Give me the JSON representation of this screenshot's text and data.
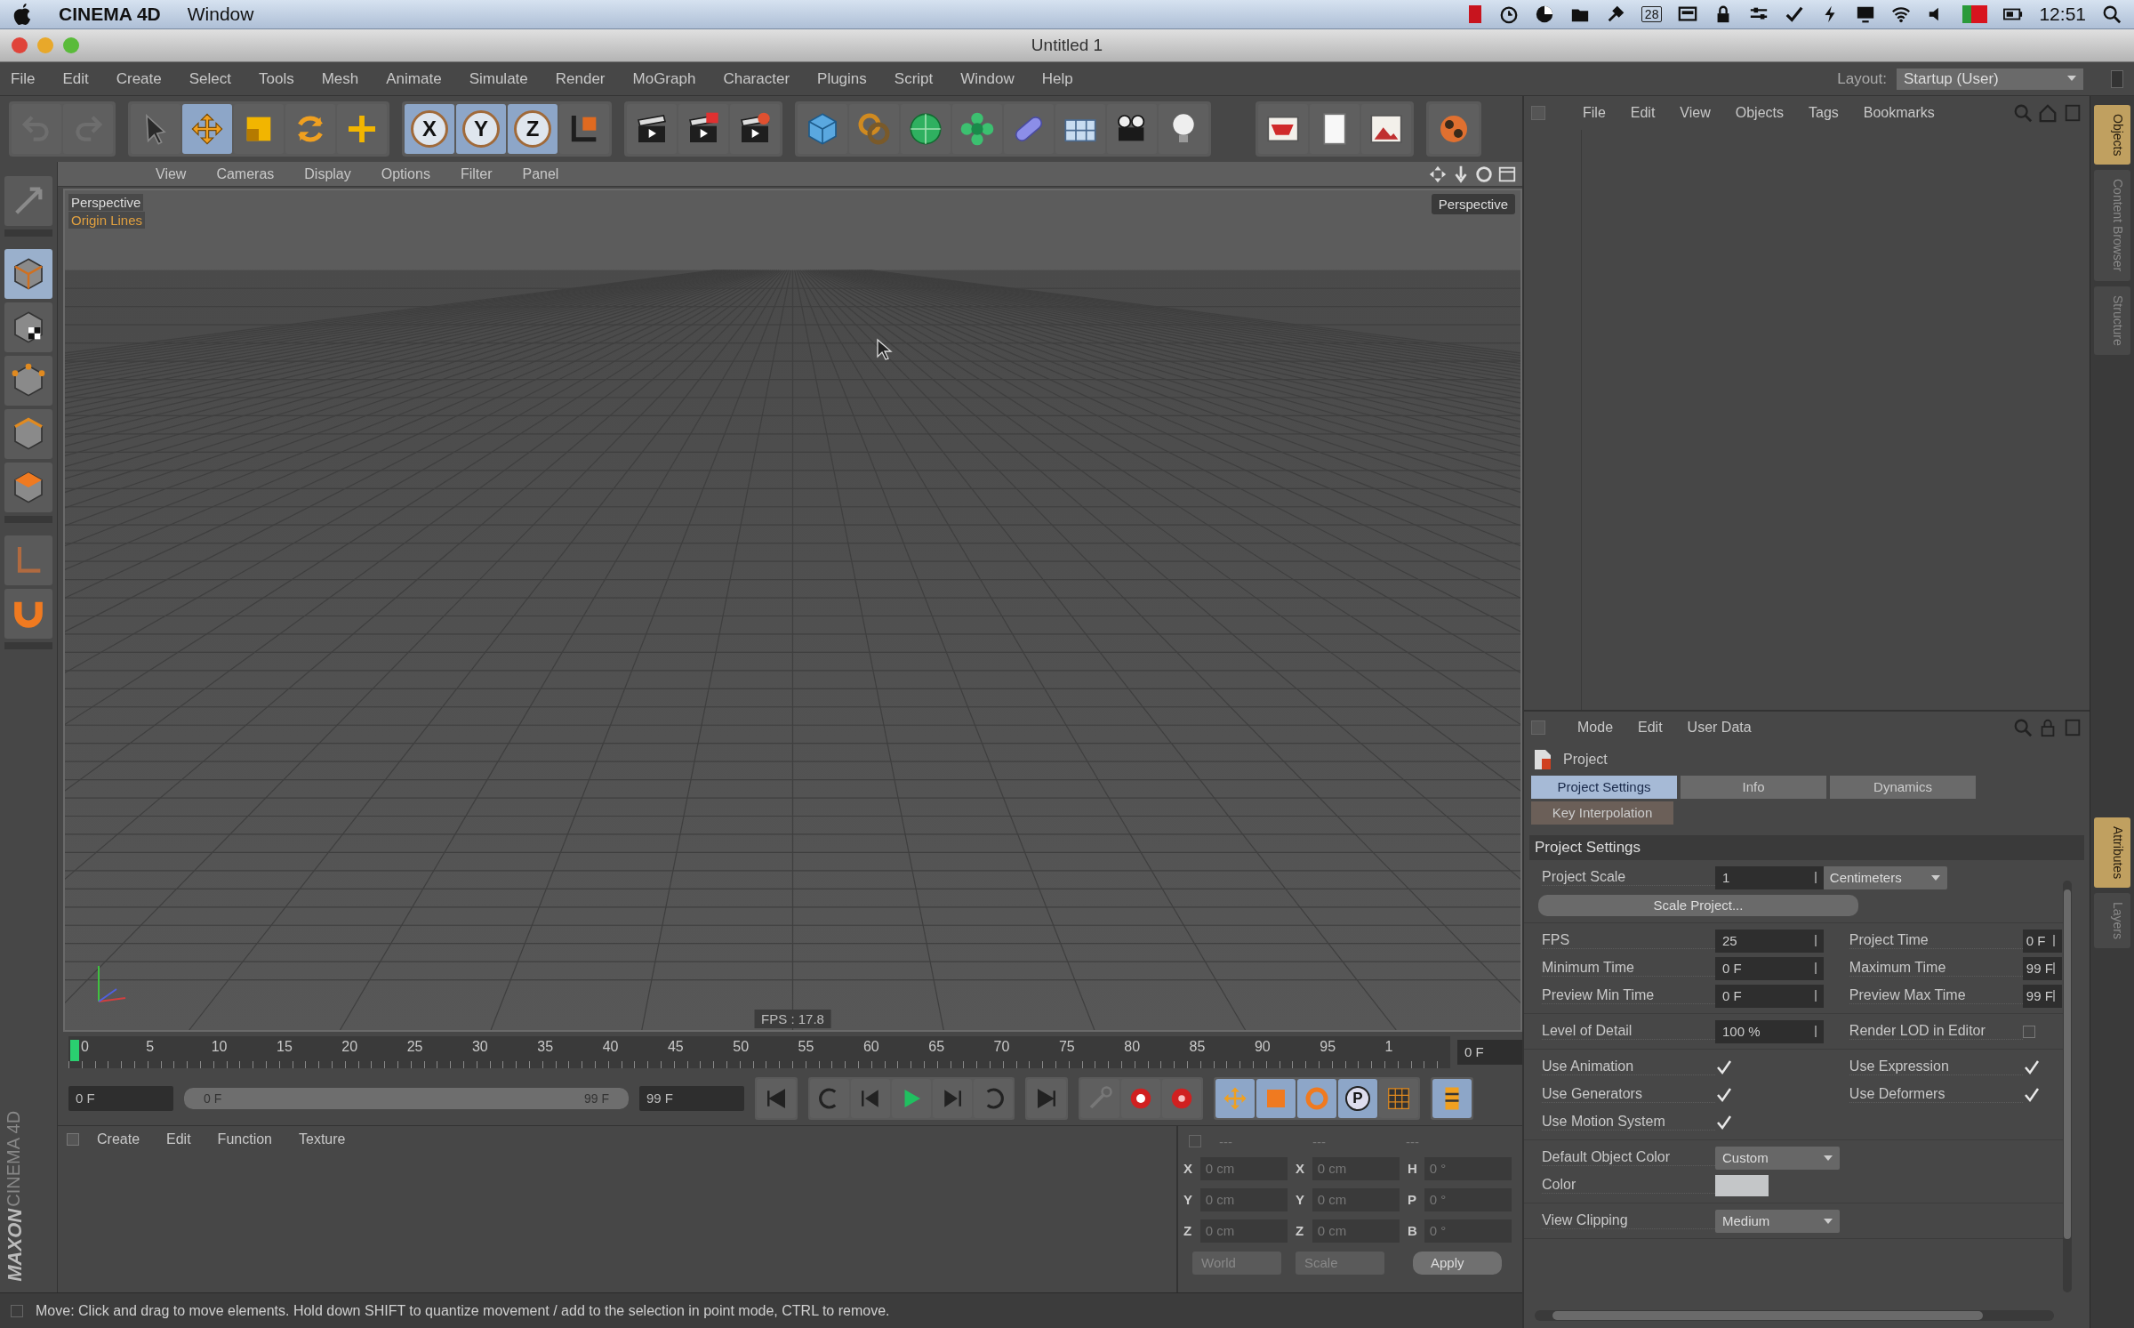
{
  "system_menu_bar": {
    "app_name": "CINEMA 4D",
    "menus": [
      "Window"
    ],
    "calendar_badge": "28",
    "clock": "12:51"
  },
  "window": {
    "title": "Untitled 1"
  },
  "main_menu": {
    "items": [
      "File",
      "Edit",
      "Create",
      "Select",
      "Tools",
      "Mesh",
      "Animate",
      "Simulate",
      "Render",
      "MoGraph",
      "Character",
      "Plugins",
      "Script",
      "Window",
      "Help"
    ],
    "layout_label": "Layout:",
    "layout_value": "Startup (User)"
  },
  "toolbar": {
    "groups": [
      [
        {
          "kind": "undo",
          "selected": false
        },
        {
          "kind": "redo",
          "selected": false
        }
      ],
      [
        {
          "kind": "select",
          "selected": false
        },
        {
          "kind": "move",
          "selected": true
        },
        {
          "kind": "scale",
          "selected": false
        },
        {
          "kind": "rotate",
          "selected": false
        },
        {
          "kind": "add",
          "selected": false
        }
      ],
      [
        {
          "kind": "axis",
          "label": "X",
          "selected": true
        },
        {
          "kind": "axis",
          "label": "Y",
          "selected": true
        },
        {
          "kind": "axis",
          "label": "Z",
          "selected": true
        },
        {
          "kind": "coords",
          "selected": false
        }
      ],
      [
        {
          "kind": "render-view",
          "selected": false
        },
        {
          "kind": "render-picture",
          "selected": false
        },
        {
          "kind": "render-settings",
          "selected": false
        }
      ],
      [
        {
          "kind": "cube",
          "selected": false
        },
        {
          "kind": "subdivision",
          "selected": false
        },
        {
          "kind": "sphere",
          "selected": false
        },
        {
          "kind": "cloner",
          "selected": false
        },
        {
          "kind": "deformer",
          "selected": false
        },
        {
          "kind": "floor",
          "selected": false
        },
        {
          "kind": "camera",
          "selected": false
        },
        {
          "kind": "light",
          "selected": false
        }
      ],
      [
        {
          "kind": "material",
          "selected": false
        },
        {
          "kind": "document",
          "selected": false
        },
        {
          "kind": "picture-viewer",
          "selected": false
        }
      ],
      [
        {
          "kind": "orb",
          "selected": false
        }
      ]
    ]
  },
  "tool_palette": [
    [
      {
        "kind": "tweak",
        "selected": false
      }
    ],
    [
      {
        "kind": "model",
        "selected": true
      },
      {
        "kind": "texture",
        "selected": false
      },
      {
        "kind": "points",
        "selected": false
      },
      {
        "kind": "edges",
        "selected": false
      },
      {
        "kind": "polygons",
        "selected": false
      }
    ],
    [
      {
        "kind": "axis-mode",
        "selected": false
      },
      {
        "kind": "snap",
        "selected": false
      }
    ]
  ],
  "logo": {
    "brand": "MAXON",
    "product": "CINEMA 4D"
  },
  "viewport": {
    "menu": [
      "View",
      "Cameras",
      "Display",
      "Options",
      "Filter",
      "Panel"
    ],
    "camera_label": "Perspective",
    "overlay_label": "Origin Lines",
    "camera_button": "Perspective",
    "fps": "FPS : 17.8"
  },
  "timeline": {
    "ruler_labels": [
      "0",
      "5",
      "10",
      "15",
      "20",
      "25",
      "30",
      "35",
      "40",
      "45",
      "50",
      "55",
      "60",
      "65",
      "70",
      "75",
      "80",
      "85",
      "90",
      "95",
      "1"
    ],
    "frame_field": "0 F"
  },
  "transport": {
    "start_field": "0 F",
    "range": {
      "start": "0 F",
      "end": "99 F",
      "level": 1
    },
    "end_field": "99 F",
    "buttons": [
      [
        {
          "kind": "to-start",
          "selected": false
        }
      ],
      [
        {
          "kind": "loop-back",
          "selected": false
        },
        {
          "kind": "prev",
          "selected": false
        },
        {
          "kind": "play",
          "selected": false
        },
        {
          "kind": "next",
          "selected": false
        },
        {
          "kind": "loop",
          "selected": false
        }
      ],
      [
        {
          "kind": "to-end",
          "selected": false
        }
      ],
      [
        {
          "kind": "key-lock",
          "selected": false
        },
        {
          "kind": "record",
          "selected": false
        },
        {
          "kind": "autokey",
          "selected": false
        }
      ],
      [
        {
          "kind": "key-move",
          "selected": true
        },
        {
          "kind": "key-scale",
          "selected": true
        },
        {
          "kind": "key-rotate",
          "selected": true
        },
        {
          "kind": "key-param",
          "label": "P",
          "selected": true
        },
        {
          "kind": "key-pla",
          "selected": false
        }
      ],
      [
        {
          "kind": "timeline",
          "selected": true
        }
      ]
    ]
  },
  "material_manager": {
    "menu": [
      "Create",
      "Edit",
      "Function",
      "Texture"
    ]
  },
  "coordinates": {
    "headers": [
      "---",
      "---",
      "---"
    ],
    "rows": [
      {
        "position_axis": "X",
        "position": "0 cm",
        "size_axis": "X",
        "size": "0 cm",
        "rotation_axis": "H",
        "rotation": "0 °"
      },
      {
        "position_axis": "Y",
        "position": "0 cm",
        "size_axis": "Y",
        "size": "0 cm",
        "rotation_axis": "P",
        "rotation": "0 °"
      },
      {
        "position_axis": "Z",
        "position": "0 cm",
        "size_axis": "Z",
        "size": "0 cm",
        "rotation_axis": "B",
        "rotation": "0 °"
      }
    ],
    "space_dropdown": "World",
    "mode_dropdown": "Scale",
    "apply_button": "Apply"
  },
  "status_bar": "Move: Click and drag to move elements. Hold down SHIFT to quantize movement / add to the selection in point mode, CTRL to remove.",
  "object_manager": {
    "menu": [
      "File",
      "Edit",
      "View",
      "Objects",
      "Tags",
      "Bookmarks"
    ]
  },
  "attribute_manager": {
    "menu": [
      "Mode",
      "Edit",
      "User Data"
    ],
    "object": "Project",
    "tabs": [
      {
        "label": "Project Settings",
        "selected": true
      },
      {
        "label": "Info",
        "selected": false
      },
      {
        "label": "Dynamics",
        "selected": false
      },
      {
        "label": "Key Interpolation",
        "selected": false
      }
    ],
    "section": "Project Settings",
    "groups": [
      [
        {
          "cells": [
            {
              "kind": "number",
              "label": "Project Scale",
              "value": "1"
            },
            {
              "kind": "dropdown",
              "value": "Centimeters"
            }
          ]
        },
        {
          "cells": [
            {
              "kind": "button",
              "label": "Scale Project..."
            }
          ]
        }
      ],
      [
        {
          "cells": [
            {
              "kind": "number",
              "label": "FPS",
              "value": "25"
            },
            {
              "kind": "number",
              "label": "Project Time",
              "value": "0 F"
            }
          ]
        },
        {
          "cells": [
            {
              "kind": "number",
              "label": "Minimum Time",
              "value": "0 F"
            },
            {
              "kind": "number",
              "label": "Maximum Time",
              "value": "99 F"
            }
          ]
        },
        {
          "cells": [
            {
              "kind": "number",
              "label": "Preview Min Time",
              "value": "0 F"
            },
            {
              "kind": "number",
              "label": "Preview Max Time",
              "value": "99 F"
            }
          ]
        }
      ],
      [
        {
          "cells": [
            {
              "kind": "number",
              "label": "Level of Detail",
              "value": "100 %"
            },
            {
              "kind": "checkbox",
              "label": "Render LOD in Editor",
              "checked": false
            }
          ]
        }
      ],
      [
        {
          "cells": [
            {
              "kind": "checkbox",
              "label": "Use Animation",
              "checked": true
            },
            {
              "kind": "checkbox",
              "label": "Use Expression",
              "checked": true
            }
          ]
        },
        {
          "cells": [
            {
              "kind": "checkbox",
              "label": "Use Generators",
              "checked": true
            },
            {
              "kind": "checkbox",
              "label": "Use Deformers",
              "checked": true
            }
          ]
        },
        {
          "cells": [
            {
              "kind": "checkbox",
              "label": "Use Motion System",
              "checked": true
            }
          ]
        }
      ],
      [
        {
          "cells": [
            {
              "kind": "dropdown",
              "label": "Default Object Color",
              "value": "Custom"
            }
          ]
        },
        {
          "cells": [
            {
              "kind": "color",
              "label": "Color",
              "color": "#c4c6c8"
            }
          ]
        }
      ],
      [
        {
          "cells": [
            {
              "kind": "dropdown",
              "label": "View Clipping",
              "value": "Medium"
            }
          ]
        }
      ]
    ]
  },
  "side_tabs": {
    "objects_panel": [
      {
        "label": "Objects",
        "selected": true
      },
      {
        "label": "Content Browser",
        "selected": false
      },
      {
        "label": "Structure",
        "selected": false
      }
    ],
    "attributes_panel": [
      {
        "label": "Attributes",
        "selected": true
      },
      {
        "label": "Layers",
        "selected": false
      }
    ]
  }
}
